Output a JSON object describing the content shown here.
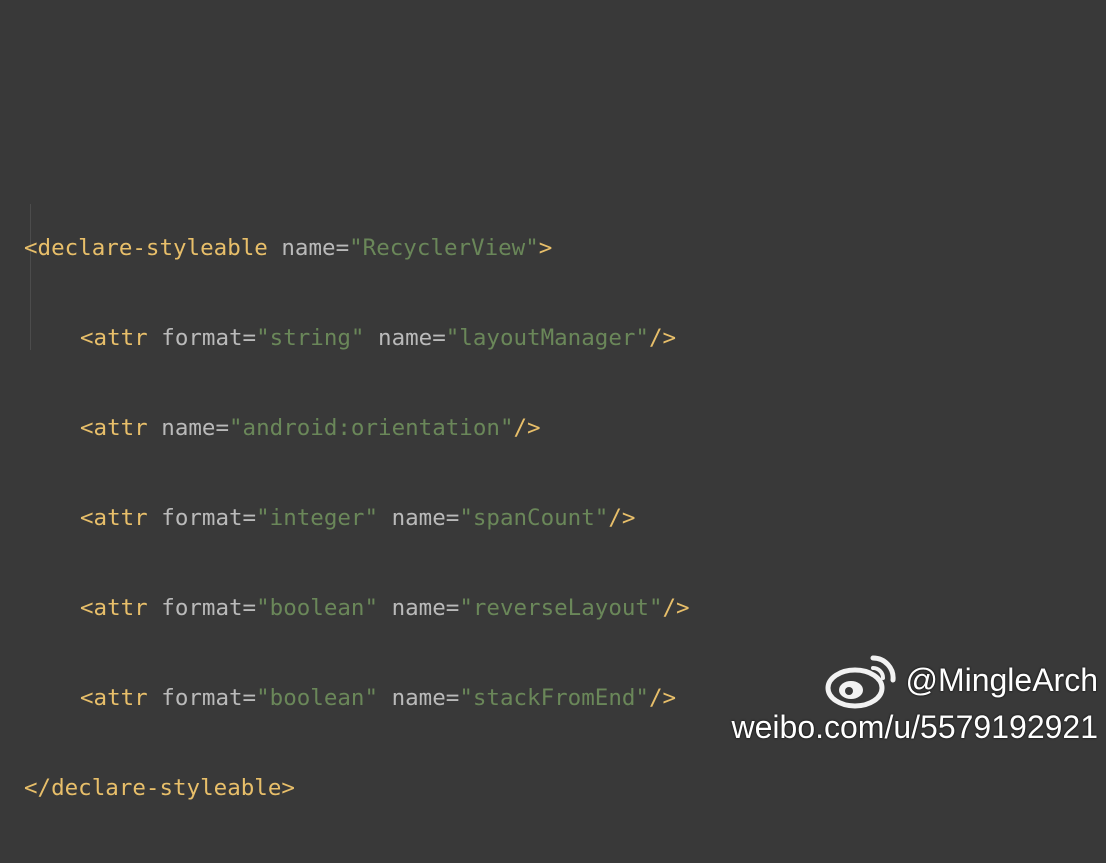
{
  "code": {
    "line1": {
      "open": "<declare-styleable ",
      "attr": "name=",
      "value": "\"RecyclerView\"",
      "close": ">"
    },
    "line2": {
      "open": "<attr ",
      "a1": "format=",
      "v1": "\"string\"",
      "a2": " name=",
      "v2": "\"layoutManager\"",
      "close": "/>"
    },
    "line3": {
      "open": "<attr ",
      "a1": "name=",
      "v1": "\"android:orientation\"",
      "close": "/>"
    },
    "line4": {
      "open": "<attr ",
      "a1": "format=",
      "v1": "\"integer\"",
      "a2": " name=",
      "v2": "\"spanCount\"",
      "close": "/>"
    },
    "line5": {
      "open": "<attr ",
      "a1": "format=",
      "v1": "\"boolean\"",
      "a2": " name=",
      "v2": "\"reverseLayout\"",
      "close": "/>"
    },
    "line6": {
      "open": "<attr ",
      "a1": "format=",
      "v1": "\"boolean\"",
      "a2": " name=",
      "v2": "\"stackFromEnd\"",
      "close": "/>"
    },
    "line7": {
      "text": "</declare-styleable>"
    }
  },
  "colors": {
    "background": "#393939",
    "tag": "#e8bf6a",
    "attribute": "#bababa",
    "value": "#6a8759"
  },
  "watermark": {
    "logo_icon": "weibo-logo-icon",
    "handle": "@MingleArch",
    "url": "weibo.com/u/5579192921"
  }
}
